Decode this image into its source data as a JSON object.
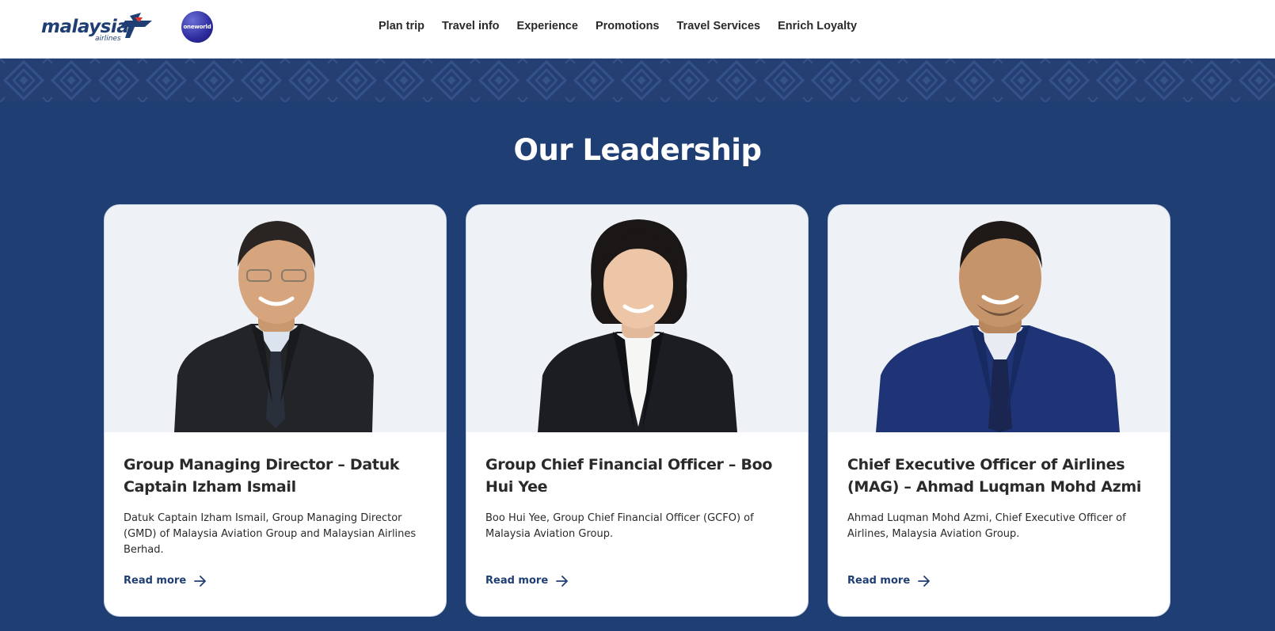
{
  "header": {
    "logo_text": "malaysia",
    "logo_sub": "airlines",
    "alliance_badge": "oneworld",
    "nav": [
      "Plan trip",
      "Travel info",
      "Experience",
      "Promotions",
      "Travel Services",
      "Enrich Loyalty"
    ]
  },
  "section": {
    "title": "Our Leadership"
  },
  "leaders": [
    {
      "title": "Group Managing Director – Datuk Captain Izham Ismail",
      "description": "Datuk Captain Izham Ismail, Group Managing Director (GMD) of Malaysia Aviation Group and Malaysian Airlines Berhad.",
      "cta": "Read more"
    },
    {
      "title": "Group Chief Financial Officer – Boo Hui Yee",
      "description": "Boo Hui Yee, Group Chief Financial Officer (GCFO) of Malaysia Aviation Group.",
      "cta": "Read more"
    },
    {
      "title": "Chief Executive Officer of Airlines (MAG) – Ahmad Luqman Mohd Azmi",
      "description": "Ahmad Luqman Mohd Azmi, Chief Executive Officer of Airlines, Malaysia Aviation Group.",
      "cta": "Read more"
    }
  ],
  "colors": {
    "brand_navy": "#1f3f74",
    "card_bg": "#ffffff",
    "photo_bg": "#eef1f5"
  },
  "icons": {
    "read_more": "arrow-right-icon",
    "logo_mark": "kite-logo-icon"
  }
}
